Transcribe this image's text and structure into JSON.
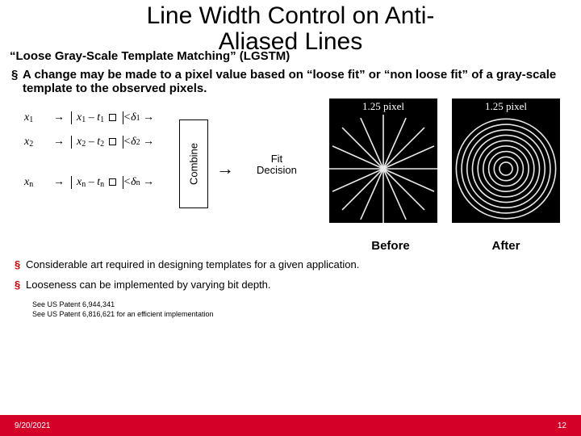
{
  "title_line1": "Line Width Control on Anti-",
  "title_line2": "Aliased Lines",
  "subtitle": "“Loose Gray-Scale Template Matching” (LGSTM)",
  "bullet_main": "A change may be made to a pixel value based on “loose fit” or “non loose fit” of a gray-scale template to the observed pixels.",
  "formula": {
    "x1": "x",
    "s1": "1",
    "x2": "x",
    "s2": "2",
    "xn": "x",
    "sn": "n",
    "t": "t",
    "d": "δ",
    "minus": " – ",
    "lt": " < ",
    "arrow": "→"
  },
  "combine_label": "Combine",
  "fit_arrow": "→",
  "fit_line1": "Fit",
  "fit_line2": "Decision",
  "fig1_label": "1.25 pixel",
  "fig2_label": "1.25 pixel",
  "caption_before": "Before",
  "caption_after": "After",
  "bullet_a": "Considerable art required in designing templates for a given application.",
  "bullet_b": "Looseness can be implemented by varying bit depth.",
  "patent1": "See US Patent 6,944,341",
  "patent2": "See US Patent 6,816,621 for an efficient implementation",
  "footer_date": "9/20/2021",
  "footer_page": "12",
  "bullet_sym": "§"
}
